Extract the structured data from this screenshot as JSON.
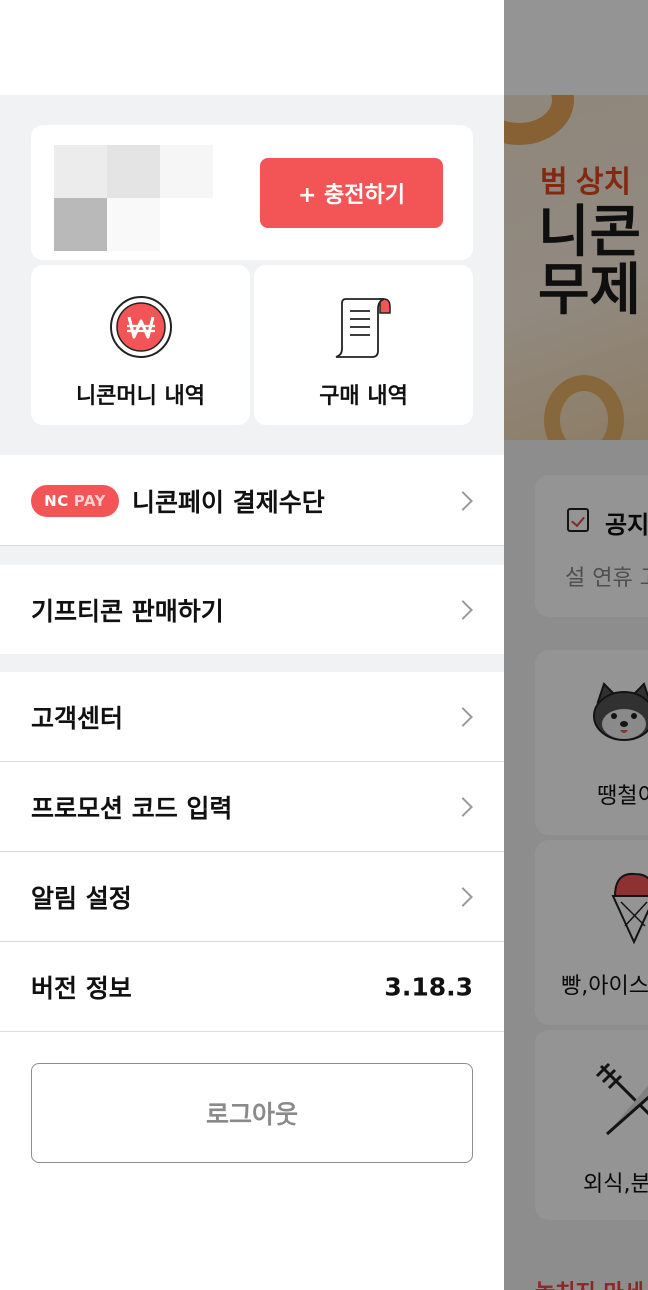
{
  "drawer": {
    "wallet": {
      "charge_button": "+ 충전하기"
    },
    "tiles": [
      {
        "label": "니콘머니 내역",
        "icon": "won-coin-icon"
      },
      {
        "label": "구매 내역",
        "icon": "receipt-icon"
      }
    ],
    "ncpay": {
      "badge_nc": "NC",
      "badge_pay": "PAY",
      "label": "니콘페이 결제수단"
    },
    "menu": [
      {
        "label": "기프티콘 판매하기"
      },
      {
        "label": "고객센터"
      },
      {
        "label": "프로모션 코드 입력"
      },
      {
        "label": "알림 설정"
      }
    ],
    "version": {
      "label": "버전 정보",
      "value": "3.18.3"
    },
    "logout_button": "로그아웃"
  },
  "background": {
    "banner_sub": "범 상치",
    "banner_title_1": "니콘",
    "banner_title_2": "무제",
    "notice_title": "공지",
    "notice_text": "설 연휴 고",
    "categories": [
      "땡철이",
      "빵,아이스",
      "외식,분"
    ],
    "bottom_text": "놓치지 마세"
  },
  "colors": {
    "accent": "#f35557",
    "dim_overlay": "rgba(0,0,0,0.42)"
  }
}
